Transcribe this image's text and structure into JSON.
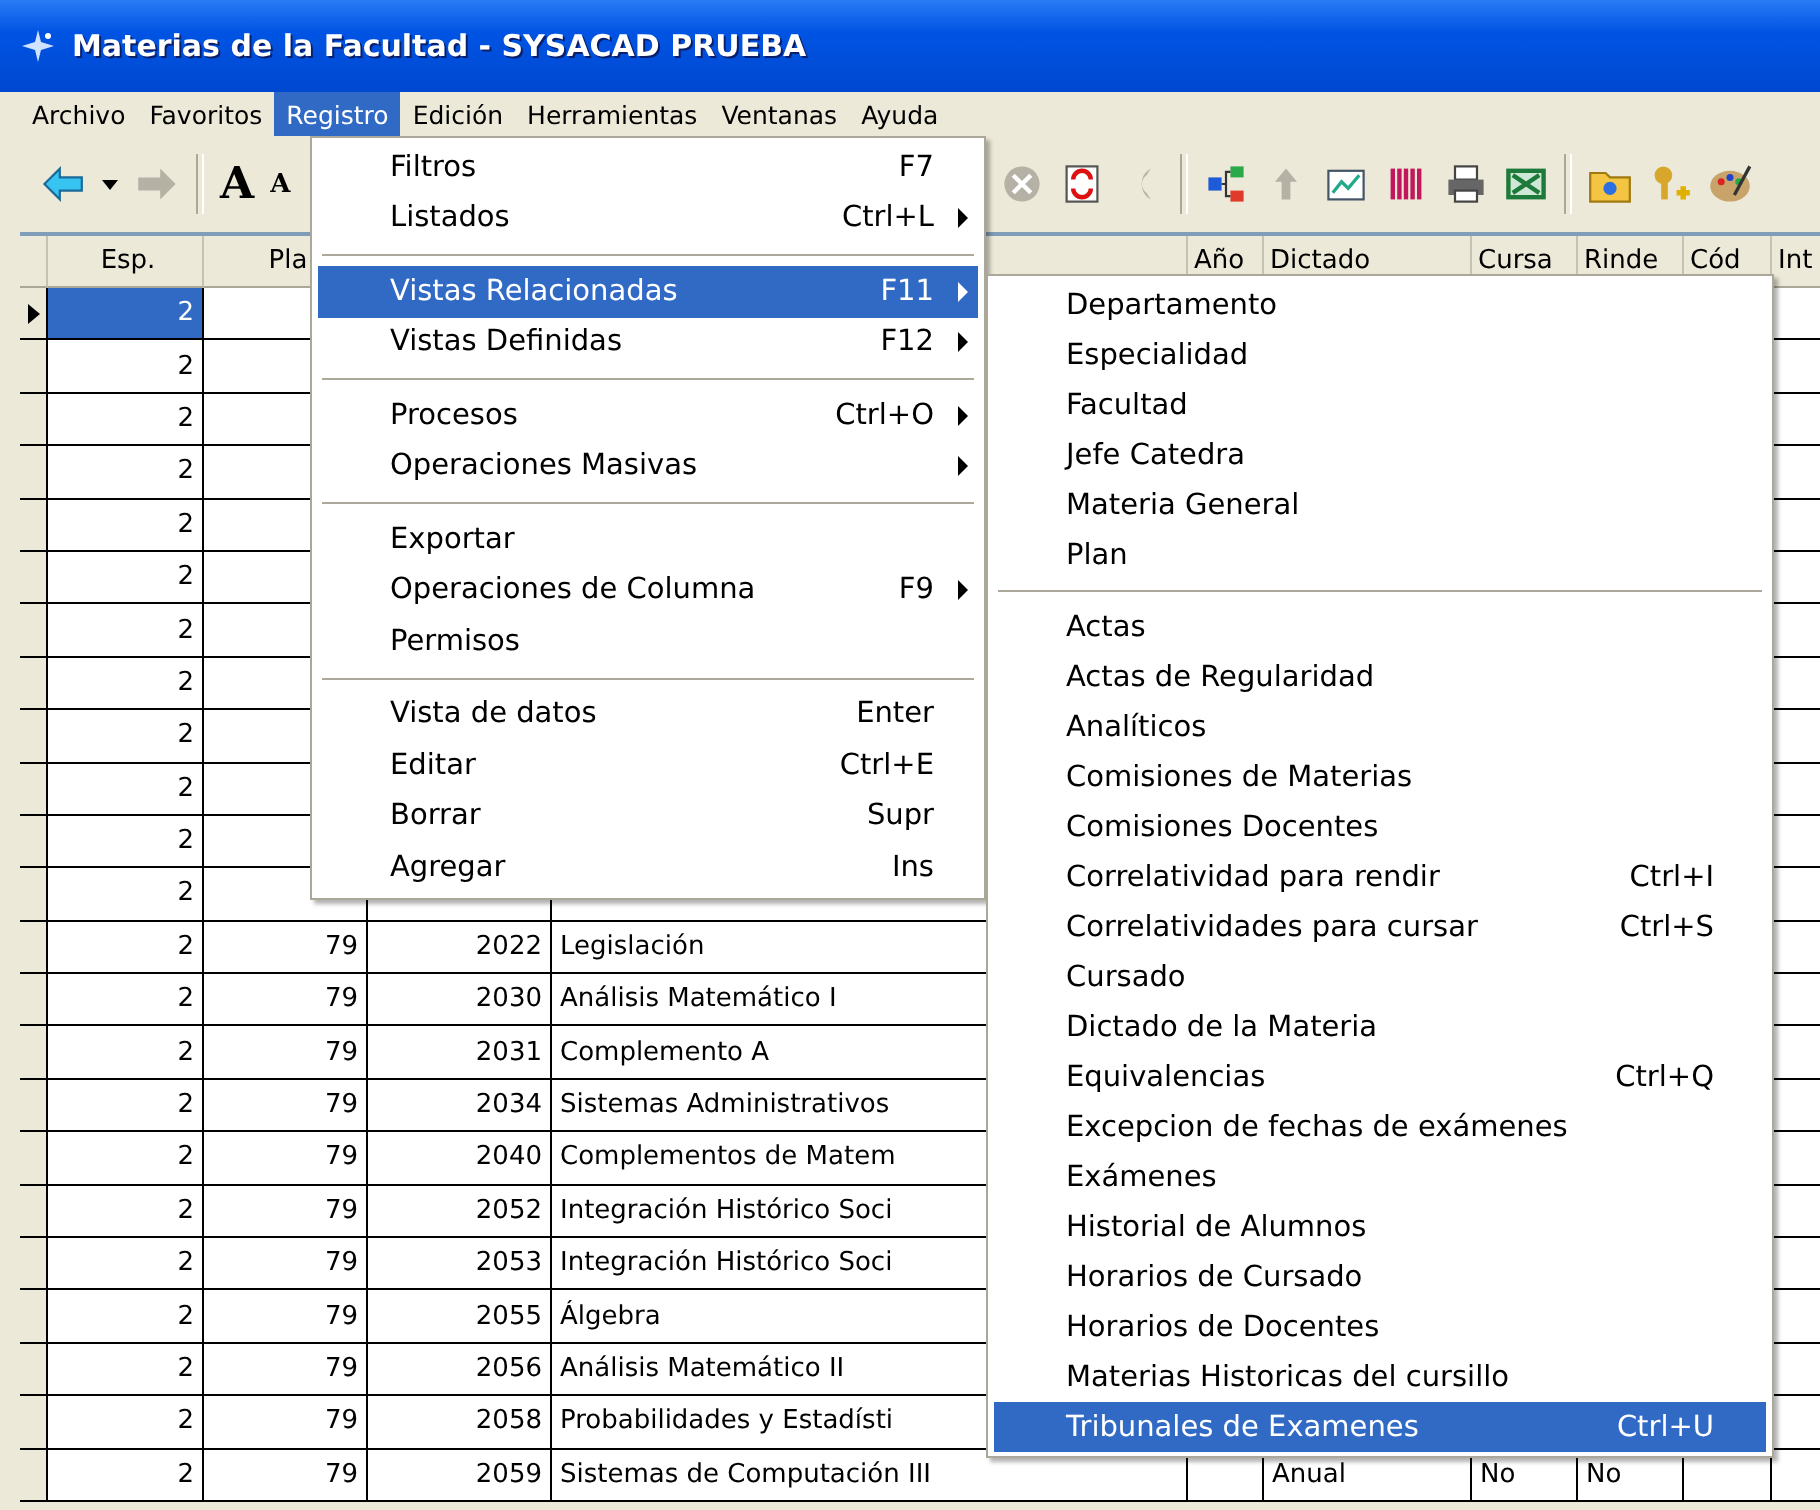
{
  "window": {
    "title": "Materias de la Facultad - SYSACAD PRUEBA"
  },
  "menu_bar": [
    {
      "label": "Archivo",
      "selected": false
    },
    {
      "label": "Favoritos",
      "selected": false
    },
    {
      "label": "Registro",
      "selected": true
    },
    {
      "label": "Edición",
      "selected": false
    },
    {
      "label": "Herramientas",
      "selected": false
    },
    {
      "label": "Ventanas",
      "selected": false
    },
    {
      "label": "Ayuda",
      "selected": false
    }
  ],
  "toolbar": {
    "left": [
      [
        {
          "kind": "back",
          "disabled": false
        },
        {
          "kind": "dropdown",
          "disabled": false
        },
        {
          "kind": "forward",
          "disabled": true
        }
      ],
      [
        {
          "kind": "font-up",
          "text": "A",
          "disabled": false
        },
        {
          "kind": "font-down",
          "text": "A",
          "disabled": false
        }
      ]
    ],
    "right": [
      [
        {
          "kind": "stop",
          "disabled": true
        },
        {
          "kind": "refresh",
          "disabled": false
        },
        {
          "kind": "undo",
          "disabled": true
        }
      ],
      [
        {
          "kind": "tree",
          "disabled": false
        },
        {
          "kind": "up",
          "disabled": true
        },
        {
          "kind": "chart",
          "disabled": false
        },
        {
          "kind": "grid",
          "disabled": false
        },
        {
          "kind": "printer",
          "disabled": false
        },
        {
          "kind": "sheet",
          "disabled": false
        }
      ],
      [
        {
          "kind": "folder",
          "disabled": false
        },
        {
          "kind": "key-add",
          "disabled": false
        },
        {
          "kind": "palette",
          "disabled": false
        }
      ]
    ]
  },
  "grid": {
    "headers": {
      "esp": "Esp.",
      "plan": "Pla",
      "year": "Año",
      "dictado": "Dictado",
      "cursa": "Cursa",
      "rinde": "Rinde",
      "cod": "Cód",
      "int": "Int"
    },
    "rows": [
      {
        "selected": true,
        "esp": "2"
      },
      {
        "selected": false,
        "esp": "2"
      },
      {
        "selected": false,
        "esp": "2"
      },
      {
        "selected": false,
        "esp": "2"
      },
      {
        "selected": false,
        "esp": "2"
      },
      {
        "selected": false,
        "esp": "2"
      },
      {
        "selected": false,
        "esp": "2"
      },
      {
        "selected": false,
        "esp": "2"
      },
      {
        "selected": false,
        "esp": "2"
      },
      {
        "selected": false,
        "esp": "2"
      },
      {
        "selected": false,
        "esp": "2"
      },
      {
        "selected": false,
        "esp": "2"
      },
      {
        "selected": false,
        "esp": "2",
        "plan": "79",
        "code": "2022",
        "name": "Legislación"
      },
      {
        "selected": false,
        "esp": "2",
        "plan": "79",
        "code": "2030",
        "name": "Análisis Matemático I"
      },
      {
        "selected": false,
        "esp": "2",
        "plan": "79",
        "code": "2031",
        "name": "Complemento A"
      },
      {
        "selected": false,
        "esp": "2",
        "plan": "79",
        "code": "2034",
        "name": "Sistemas Administrativos"
      },
      {
        "selected": false,
        "esp": "2",
        "plan": "79",
        "code": "2040",
        "name": "Complementos de Matem"
      },
      {
        "selected": false,
        "esp": "2",
        "plan": "79",
        "code": "2052",
        "name": "Integración Histórico Soci"
      },
      {
        "selected": false,
        "esp": "2",
        "plan": "79",
        "code": "2053",
        "name": "Integración Histórico Soci"
      },
      {
        "selected": false,
        "esp": "2",
        "plan": "79",
        "code": "2055",
        "name": "Álgebra"
      },
      {
        "selected": false,
        "esp": "2",
        "plan": "79",
        "code": "2056",
        "name": "Análisis Matemático II"
      },
      {
        "selected": false,
        "esp": "2",
        "plan": "79",
        "code": "2058",
        "name": "Probabilidades y Estadísti"
      },
      {
        "selected": false,
        "esp": "2",
        "plan": "79",
        "code": "2059",
        "name": "Sistemas de Computación III",
        "dictado": "Anual",
        "cursa": "No",
        "rinde": "No"
      }
    ]
  },
  "registro_menu": {
    "groups": [
      [
        {
          "label": "Filtros",
          "shortcut": "F7",
          "submenu": false,
          "selected": false
        },
        {
          "label": "Listados",
          "shortcut": "Ctrl+L",
          "submenu": true,
          "selected": false
        }
      ],
      [
        {
          "label": "Vistas Relacionadas",
          "shortcut": "F11",
          "submenu": true,
          "selected": true
        },
        {
          "label": "Vistas Definidas",
          "shortcut": "F12",
          "submenu": true,
          "selected": false
        }
      ],
      [
        {
          "label": "Procesos",
          "shortcut": "Ctrl+O",
          "submenu": true,
          "selected": false
        },
        {
          "label": "Operaciones Masivas",
          "submenu": true,
          "selected": false
        }
      ],
      [
        {
          "label": "Exportar",
          "submenu": false,
          "selected": false
        },
        {
          "label": "Operaciones de Columna",
          "shortcut": "F9",
          "submenu": true,
          "selected": false
        },
        {
          "label": "Permisos",
          "submenu": false,
          "selected": false
        }
      ],
      [
        {
          "label": "Vista de datos",
          "shortcut": "Enter",
          "submenu": false,
          "selected": false
        },
        {
          "label": "Editar",
          "shortcut": "Ctrl+E",
          "submenu": false,
          "selected": false
        },
        {
          "label": "Borrar",
          "shortcut": "Supr",
          "submenu": false,
          "selected": false
        },
        {
          "label": "Agregar",
          "shortcut": "Ins",
          "submenu": false,
          "selected": false
        }
      ]
    ]
  },
  "vistas_submenu": {
    "groups": [
      [
        {
          "label": "Departamento",
          "selected": false
        },
        {
          "label": "Especialidad",
          "selected": false
        },
        {
          "label": "Facultad",
          "selected": false
        },
        {
          "label": "Jefe Catedra",
          "selected": false
        },
        {
          "label": "Materia General",
          "selected": false
        },
        {
          "label": "Plan",
          "selected": false
        }
      ],
      [
        {
          "label": "Actas",
          "selected": false
        },
        {
          "label": "Actas de Regularidad",
          "selected": false
        },
        {
          "label": "Analíticos",
          "selected": false
        },
        {
          "label": "Comisiones de Materias",
          "selected": false
        },
        {
          "label": "Comisiones Docentes",
          "selected": false
        },
        {
          "label": "Correlatividad para rendir",
          "shortcut": "Ctrl+I",
          "selected": false
        },
        {
          "label": "Correlatividades para cursar",
          "shortcut": "Ctrl+S",
          "selected": false
        },
        {
          "label": "Cursado",
          "selected": false
        },
        {
          "label": "Dictado de la Materia",
          "selected": false
        },
        {
          "label": "Equivalencias",
          "shortcut": "Ctrl+Q",
          "selected": false
        },
        {
          "label": "Excepcion de fechas de exámenes",
          "selected": false
        },
        {
          "label": "Exámenes",
          "selected": false
        },
        {
          "label": "Historial de Alumnos",
          "selected": false
        },
        {
          "label": "Horarios de Cursado",
          "selected": false
        },
        {
          "label": "Horarios de Docentes",
          "selected": false
        },
        {
          "label": "Materias Historicas del cursillo",
          "selected": false
        },
        {
          "label": "Tribunales de Examenes",
          "shortcut": "Ctrl+U",
          "selected": true
        }
      ]
    ]
  }
}
